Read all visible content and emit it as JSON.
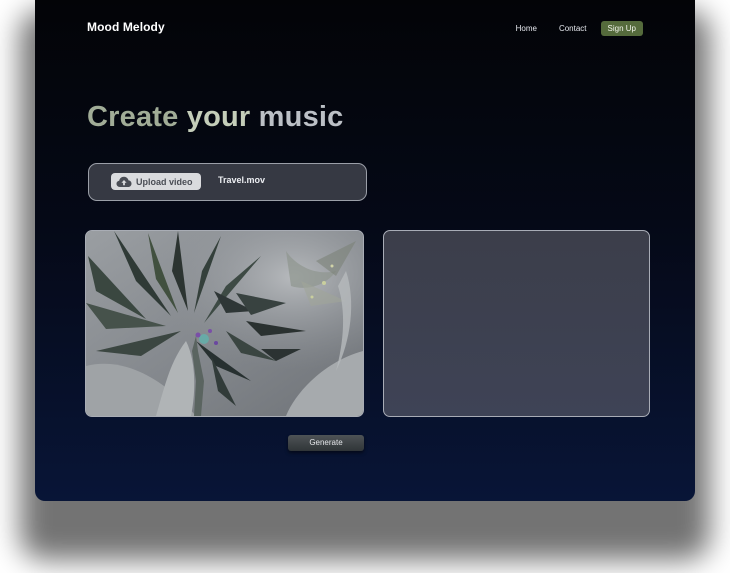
{
  "brand": {
    "name": "Mood Melody"
  },
  "nav": {
    "home": "Home",
    "contact": "Contact",
    "signup": "Sign Up"
  },
  "hero": {
    "word1": "Create",
    "word2": "your",
    "word3": "music"
  },
  "upload": {
    "button_label": "Upload video",
    "file_name": "Travel.mov"
  },
  "actions": {
    "generate_label": "Generate"
  },
  "colors": {
    "accent": "#556b3c",
    "background_top": "#030407",
    "background_bottom": "#081537",
    "panel": "#363943"
  },
  "icons": {
    "upload": "cloud-upload-icon"
  }
}
